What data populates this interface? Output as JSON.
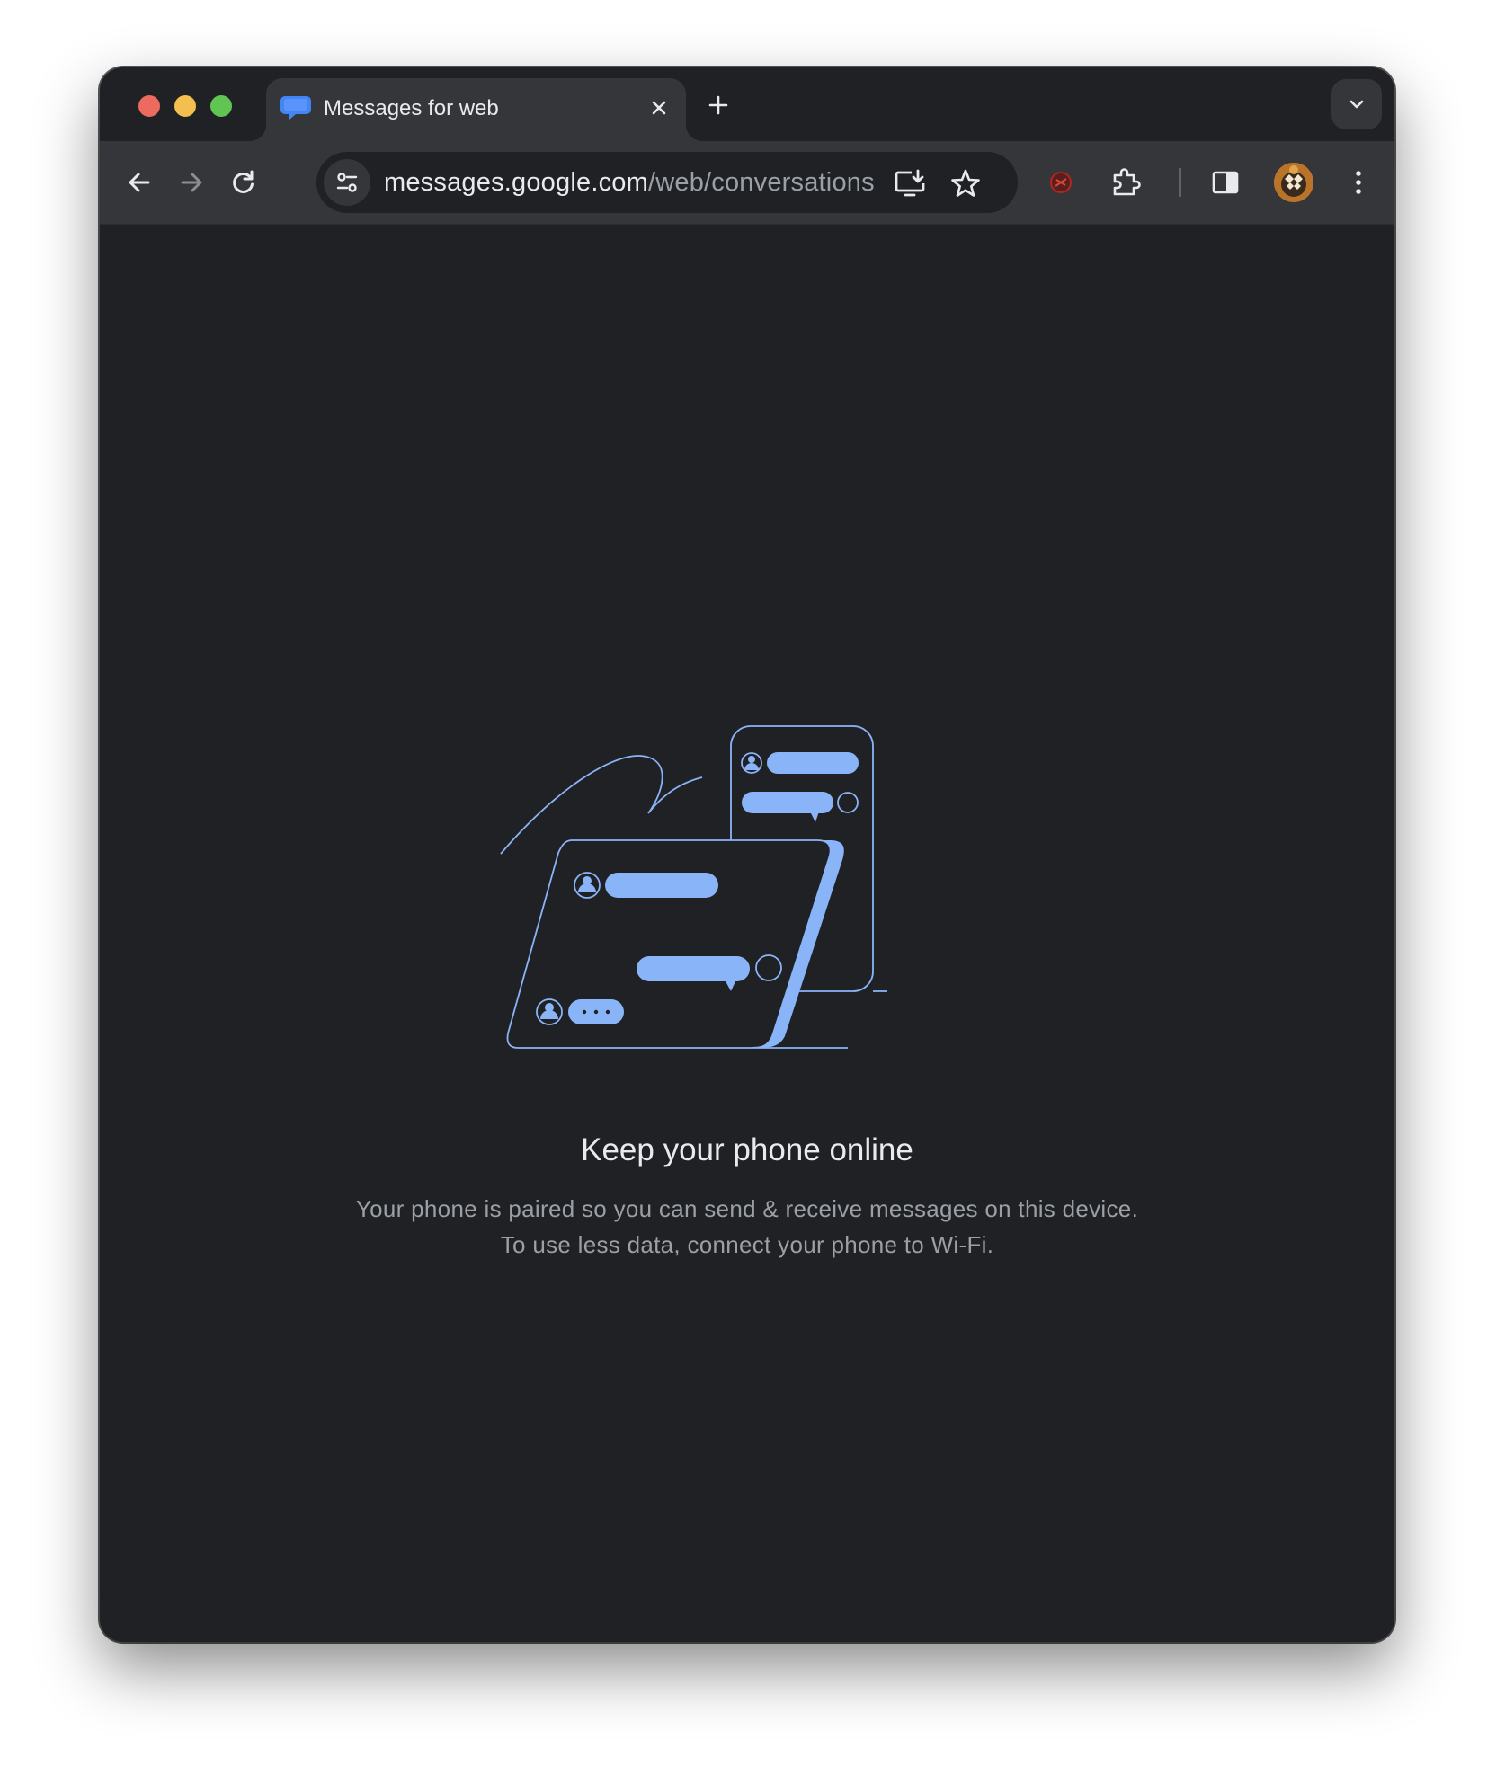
{
  "browser": {
    "tab": {
      "title": "Messages for web",
      "favicon": "messages-chat-bubble-icon"
    },
    "omnibox": {
      "url_host": "messages.google.com",
      "url_path": "/web/conversations"
    },
    "colors": {
      "accent": "#8ab4f8",
      "background": "#202124",
      "toolbar": "#35363a"
    }
  },
  "page": {
    "headline": "Keep your phone online",
    "description": "Your phone is paired so you can send & receive messages on this device. To use less data, connect your phone to Wi-Fi."
  }
}
